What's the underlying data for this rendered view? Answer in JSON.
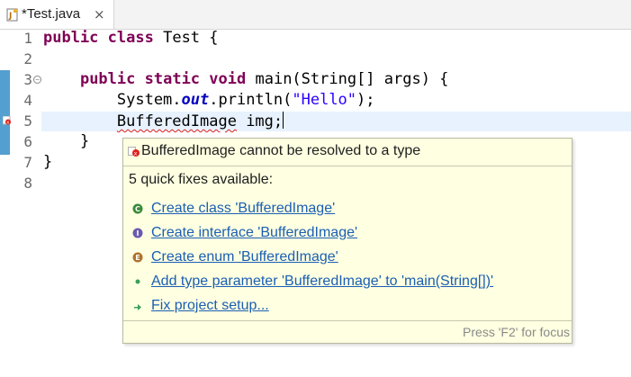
{
  "tab": {
    "label": "*Test.java",
    "close_glyph": "×",
    "icon": "java-file-icon"
  },
  "editor": {
    "line_numbers": [
      "1",
      "2",
      "3",
      "4",
      "5",
      "6",
      "7",
      "8"
    ],
    "lines": [
      "public class Test {",
      "",
      "    public static void main(String[] args) {",
      "        System.out.println(\"Hello\");",
      "        BufferedImage img;",
      "    }",
      "}",
      ""
    ],
    "error_line": "5",
    "colors": {
      "keyword": "#7f0055",
      "string": "#2a00ff",
      "field": "#0000c0",
      "change_bar": "#1a7fbf",
      "error": "#e0201b",
      "current_line": "#e8f2fe"
    }
  },
  "quickfix": {
    "header": "BufferedImage cannot be resolved to a type",
    "subtitle": "5 quick fixes available:",
    "fixes": [
      {
        "label": "Create class 'BufferedImage'",
        "icon": "class-icon",
        "color": "#3a8a3a"
      },
      {
        "label": "Create interface 'BufferedImage'",
        "icon": "interface-icon",
        "color": "#6a5ab0"
      },
      {
        "label": "Create enum 'BufferedImage'",
        "icon": "enum-icon",
        "color": "#b0702a"
      },
      {
        "label": "Add type parameter 'BufferedImage' to 'main(String[])'",
        "icon": "type-parameter-icon",
        "color": "#3aa05a"
      },
      {
        "label": "Fix project setup...",
        "icon": "fix-setup-icon",
        "color": "#3aa05a"
      }
    ],
    "footer": "Press 'F2' for focus",
    "background": "#ffffe1"
  }
}
